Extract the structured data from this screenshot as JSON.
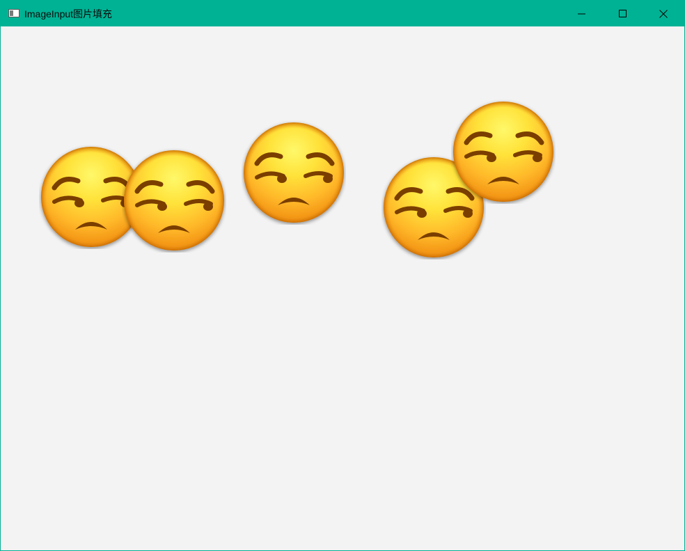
{
  "window": {
    "title": "ImageInput图片填充",
    "accent_color": "#00b294",
    "background_color": "#f3f3f3"
  },
  "controls": {
    "minimize_icon": "minimize-icon",
    "maximize_icon": "maximize-icon",
    "close_icon": "close-icon"
  },
  "canvas": {
    "images": [
      {
        "icon": "unamused-face-icon"
      },
      {
        "icon": "unamused-face-icon"
      },
      {
        "icon": "unamused-face-icon"
      },
      {
        "icon": "unamused-face-icon"
      },
      {
        "icon": "unamused-face-icon"
      }
    ]
  }
}
